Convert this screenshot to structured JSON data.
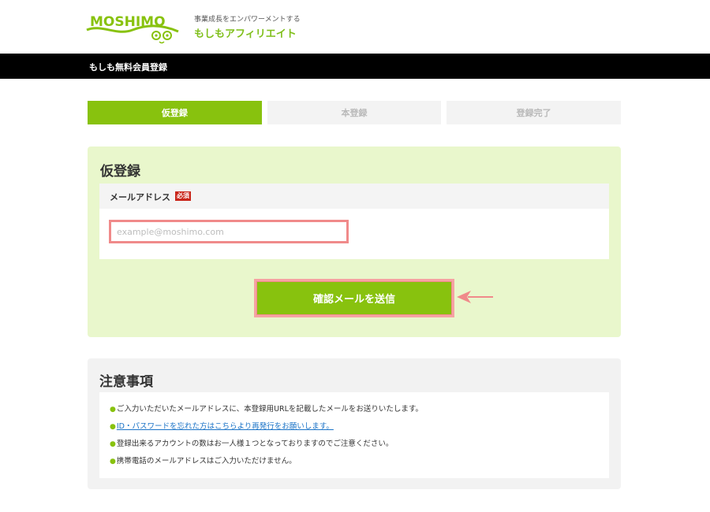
{
  "header": {
    "logo_text": "MOSHIMO",
    "tagline": "事業成長をエンパワーメントする",
    "brand_name": "もしもアフィリエイト"
  },
  "titlebar": {
    "text": "もしも無料会員登録"
  },
  "steps": [
    {
      "label": "仮登録",
      "active": true
    },
    {
      "label": "本登録",
      "active": false
    },
    {
      "label": "登録完了",
      "active": false
    }
  ],
  "registration": {
    "title": "仮登録",
    "email_label": "メールアドレス",
    "required_badge": "必須",
    "email_value": "",
    "email_placeholder": "example@moshimo.com",
    "send_button": "確認メールを送信"
  },
  "notes": {
    "title": "注意事項",
    "items": [
      "ご入力いただいたメールアドレスに、本登録用URLを記載したメールをお送りいたします。",
      "ID・パスワードを忘れた方はこちらより再発行をお願いします。",
      "登録出来るアカウントの数はお一人様１つとなっておりますのでご注意ください。",
      "携帯電話のメールアドレスはご入力いただけません。"
    ]
  },
  "colors": {
    "brand_green": "#88c20e",
    "panel_green": "#e9f7cc",
    "highlight_pink": "#f08a8a",
    "required_red": "#c9261b"
  }
}
